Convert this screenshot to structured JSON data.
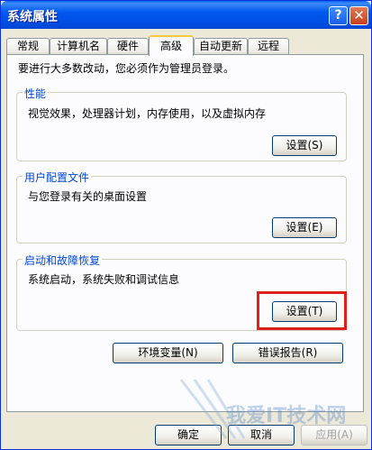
{
  "window": {
    "title": "系统属性"
  },
  "titlebar": {
    "help_icon": "?",
    "close_icon": "✕"
  },
  "tabs": [
    "常规",
    "计算机名",
    "硬件",
    "高级",
    "自动更新",
    "远程"
  ],
  "active_tab": "高级",
  "note": "要进行大多数改动，您必须作为管理员登录。",
  "groups": [
    {
      "title": "性能",
      "desc": "视觉效果，处理器计划，内存使用，以及虚拟内存",
      "button": "设置(S)"
    },
    {
      "title": "用户配置文件",
      "desc": "与您登录有关的桌面设置",
      "button": "设置(E)"
    },
    {
      "title": "启动和故障恢复",
      "desc": "系统启动，系统失败和调试信息",
      "button": "设置(T)"
    }
  ],
  "buttons": {
    "env": "环境变量(N)",
    "error": "错误报告(R)",
    "ok": "确定",
    "cancel": "取消",
    "apply": "应用(A)"
  },
  "watermark": "我爱IT技术网"
}
